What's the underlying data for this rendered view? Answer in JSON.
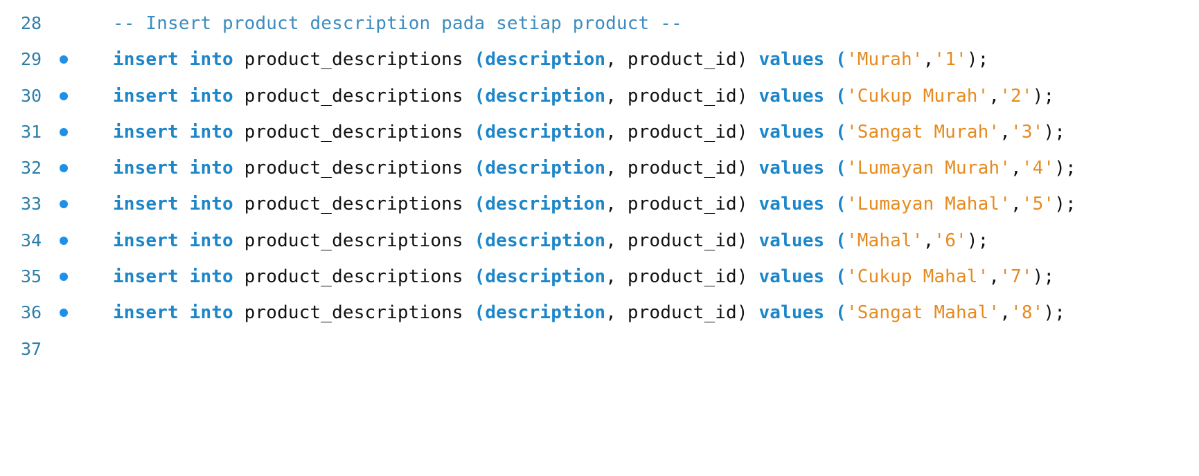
{
  "editor": {
    "lines": [
      {
        "num": "28",
        "marker": false,
        "type": "comment",
        "text": "-- Insert product description pada setiap product --"
      },
      {
        "num": "29",
        "marker": true,
        "type": "insert",
        "kw1": "insert",
        "kw2": "into",
        "table": "product_descriptions",
        "col1": "description",
        "col2": "product_id",
        "kw3": "values",
        "desc": "'Murah'",
        "pid": "'1'"
      },
      {
        "num": "30",
        "marker": true,
        "type": "insert",
        "kw1": "insert",
        "kw2": "into",
        "table": "product_descriptions",
        "col1": "description",
        "col2": "product_id",
        "kw3": "values",
        "desc": "'Cukup Murah'",
        "pid": "'2'"
      },
      {
        "num": "31",
        "marker": true,
        "type": "insert",
        "kw1": "insert",
        "kw2": "into",
        "table": "product_descriptions",
        "col1": "description",
        "col2": "product_id",
        "kw3": "values",
        "desc": "'Sangat Murah'",
        "pid": "'3'"
      },
      {
        "num": "32",
        "marker": true,
        "type": "insert",
        "kw1": "insert",
        "kw2": "into",
        "table": "product_descriptions",
        "col1": "description",
        "col2": "product_id",
        "kw3": "values",
        "desc": "'Lumayan Murah'",
        "pid": "'4'"
      },
      {
        "num": "33",
        "marker": true,
        "type": "insert",
        "kw1": "insert",
        "kw2": "into",
        "table": "product_descriptions",
        "col1": "description",
        "col2": "product_id",
        "kw3": "values",
        "desc": "'Lumayan Mahal'",
        "pid": "'5'"
      },
      {
        "num": "34",
        "marker": true,
        "type": "insert",
        "kw1": "insert",
        "kw2": "into",
        "table": "product_descriptions",
        "col1": "description",
        "col2": "product_id",
        "kw3": "values",
        "desc": "'Mahal'",
        "pid": "'6'"
      },
      {
        "num": "35",
        "marker": true,
        "type": "insert",
        "kw1": "insert",
        "kw2": "into",
        "table": "product_descriptions",
        "col1": "description",
        "col2": "product_id",
        "kw3": "values",
        "desc": "'Cukup Mahal'",
        "pid": "'7'"
      },
      {
        "num": "36",
        "marker": true,
        "type": "insert",
        "kw1": "insert",
        "kw2": "into",
        "table": "product_descriptions",
        "col1": "description",
        "col2": "product_id",
        "kw3": "values",
        "desc": "'Sangat Mahal'",
        "pid": "'8'"
      },
      {
        "num": "37",
        "marker": false,
        "type": "empty"
      }
    ]
  },
  "colors": {
    "keyword": "#1c86c9",
    "string": "#e68a1f",
    "comment": "#3d8cbf",
    "line_number": "#2d7ea8",
    "marker": "#1e90e8"
  }
}
